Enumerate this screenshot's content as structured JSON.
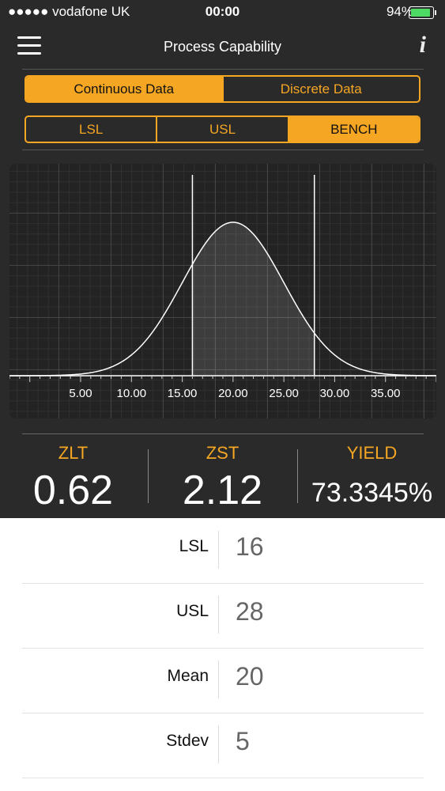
{
  "status_bar": {
    "carrier": "●●●●● vodafone UK",
    "time": "00:00",
    "battery": "94%"
  },
  "header": {
    "title": "Process Capability",
    "info_label": "i"
  },
  "data_type_tabs": [
    {
      "label": "Continuous Data",
      "active": true
    },
    {
      "label": "Discrete Data",
      "active": false
    }
  ],
  "limit_tabs": [
    {
      "label": "LSL",
      "active": false
    },
    {
      "label": "USL",
      "active": false
    },
    {
      "label": "BENCH",
      "active": true
    }
  ],
  "chart_data": {
    "type": "area",
    "title": "",
    "xlabel": "",
    "ylabel": "",
    "distribution": "normal",
    "mean": 20,
    "stdev": 5,
    "lsl": 16,
    "usl": 28,
    "x_ticks": [
      "5.00",
      "10.00",
      "15.00",
      "20.00",
      "25.00",
      "30.00",
      "35.00"
    ],
    "xlim": [
      -2,
      40
    ],
    "shaded_between": [
      16,
      28
    ],
    "grid": true
  },
  "metrics": {
    "zlt": {
      "label": "ZLT",
      "value": "0.62"
    },
    "zst": {
      "label": "ZST",
      "value": "2.12"
    },
    "yield": {
      "label": "YIELD",
      "value": "73.3345%"
    }
  },
  "inputs": [
    {
      "label": "LSL",
      "value": "16"
    },
    {
      "label": "USL",
      "value": "28"
    },
    {
      "label": "Mean",
      "value": "20"
    },
    {
      "label": "Stdev",
      "value": "5"
    }
  ],
  "colors": {
    "accent": "#f5a623",
    "background": "#2a2a2a",
    "battery": "#4cd964"
  }
}
